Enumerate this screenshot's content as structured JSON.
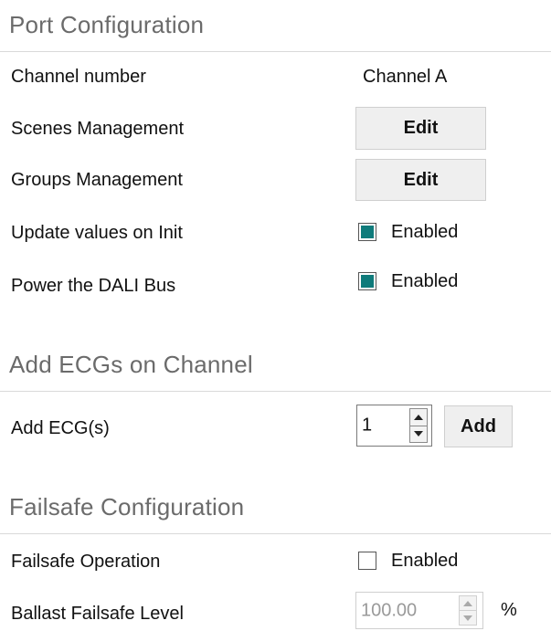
{
  "port_configuration": {
    "title": "Port Configuration",
    "channel_number": {
      "label": "Channel number",
      "value": "Channel A"
    },
    "scenes_management": {
      "label": "Scenes Management",
      "button": "Edit"
    },
    "groups_management": {
      "label": "Groups Management",
      "button": "Edit"
    },
    "update_values_on_init": {
      "label": "Update values on Init",
      "checkbox_label": "Enabled",
      "checked": true
    },
    "power_dali_bus": {
      "label": "Power the DALI Bus",
      "checkbox_label": "Enabled",
      "checked": true
    }
  },
  "add_ecgs": {
    "title": "Add ECGs on Channel",
    "add_ecg": {
      "label": "Add ECG(s)",
      "count": "1",
      "button": "Add"
    }
  },
  "failsafe_configuration": {
    "title": "Failsafe Configuration",
    "failsafe_operation": {
      "label": "Failsafe Operation",
      "checkbox_label": "Enabled",
      "checked": false
    },
    "ballast_failsafe_level": {
      "label": "Ballast Failsafe Level",
      "value": "100.00",
      "unit": "%",
      "disabled": true
    }
  },
  "colors": {
    "accent": "#0f7b7b",
    "section_title": "#6b6b6b"
  }
}
